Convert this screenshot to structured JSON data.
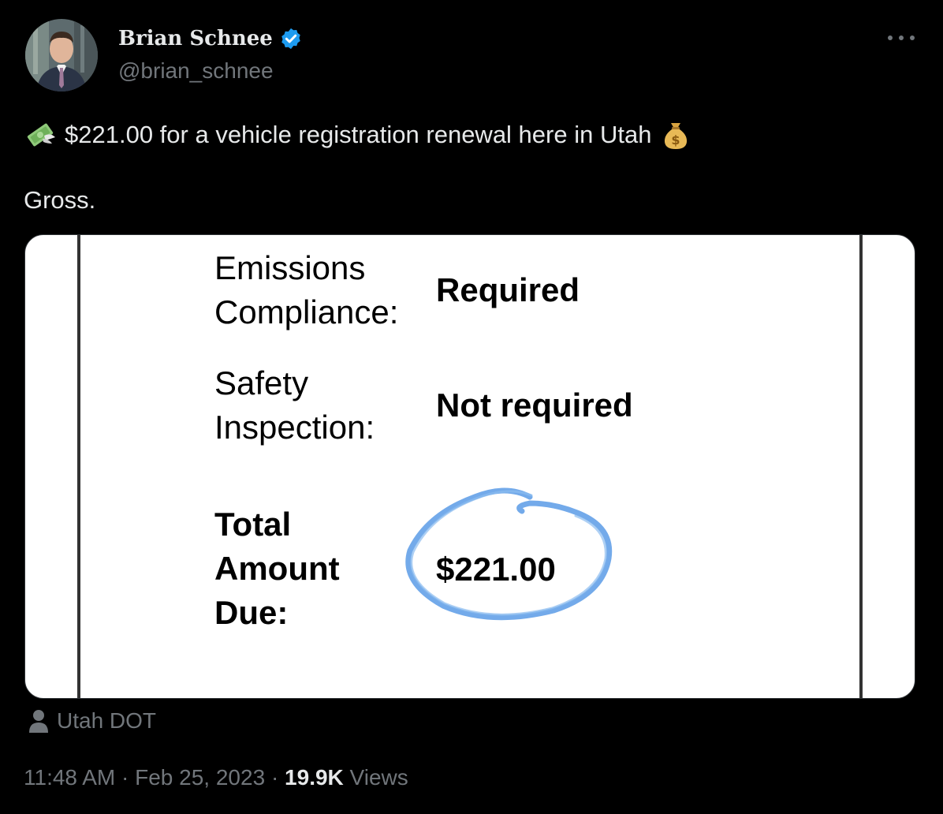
{
  "author": {
    "display_name": "Brian Schnee",
    "handle": "@brian_schnee",
    "verified": true,
    "avatar_icon": "profile-photo"
  },
  "tweet": {
    "line1_emoji_start": "money-with-wings-emoji",
    "line1_text": "$221.00 for a vehicle registration renewal here in Utah",
    "line1_emoji_end": "money-bag-emoji",
    "line2_text": "Gross."
  },
  "media": {
    "rows": [
      {
        "label_line1": "Emissions",
        "label_line2": "Compliance:",
        "value": "Required"
      },
      {
        "label_line1": "Safety",
        "label_line2": "Inspection:",
        "value": "Not required"
      }
    ],
    "total": {
      "label_line1": "Total",
      "label_line2": "Amount",
      "label_line3": "Due:",
      "value": "$221.00",
      "circle_color": "#5b9be6"
    }
  },
  "source_label": "Utah DOT",
  "meta": {
    "time": "11:48 AM",
    "sep1": "·",
    "date": "Feb 25, 2023",
    "sep2": "·",
    "views_count": "19.9K",
    "views_label": "Views"
  },
  "colors": {
    "background": "#000000",
    "text_primary": "#e7e9ea",
    "text_secondary": "#71767b",
    "verified_badge": "#1d9bf0"
  }
}
